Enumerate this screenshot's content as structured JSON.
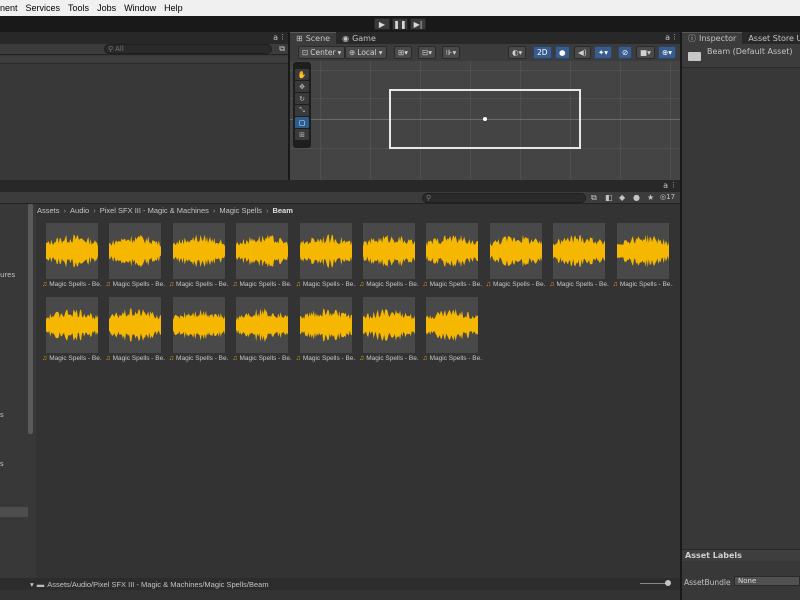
{
  "menu": [
    "nent",
    "Services",
    "Tools",
    "Jobs",
    "Window",
    "Help"
  ],
  "playbar": {
    "play": "▶",
    "pause": "❚❚",
    "step": "▶|"
  },
  "hierarchy": {
    "search_placeholder": "All",
    "lock": "a"
  },
  "scene": {
    "tabs": [
      "Scene",
      "Game"
    ],
    "pivot": "Center",
    "space": "Local",
    "mode2d": "2D",
    "lock": "a"
  },
  "project": {
    "lock": "a",
    "breadcrumb": [
      "Assets",
      "Audio",
      "Pixel SFX III - Magic & Machines",
      "Magic Spells",
      "Beam"
    ],
    "count": "17",
    "status_path": "Assets/Audio/Pixel SFX III - Magic & Machines/Magic Spells/Beam",
    "assets": [
      "Magic Spells - Be...",
      "Magic Spells - Be...",
      "Magic Spells - Be...",
      "Magic Spells - Be...",
      "Magic Spells - Be...",
      "Magic Spells - Be...",
      "Magic Spells - Be...",
      "Magic Spells - Be...",
      "Magic Spells - Be...",
      "Magic Spells - Be...",
      "Magic Spells - Be...",
      "Magic Spells - Be...",
      "Magic Spells - Be...",
      "Magic Spells - Be...",
      "Magic Spells - Be...",
      "Magic Spells - Be...",
      "Magic Spells - Be..."
    ],
    "left_fragments": [
      "ures",
      "s",
      "s"
    ]
  },
  "inspector": {
    "tabs": [
      "Inspector",
      "Asset Store Uploade"
    ],
    "title": "Beam (Default Asset)",
    "labels_header": "Asset Labels",
    "assetbundle_label": "AssetBundle",
    "assetbundle_value": "None"
  },
  "colors": {
    "waveform": "#f5b700",
    "selection": "#2c5d8f"
  }
}
